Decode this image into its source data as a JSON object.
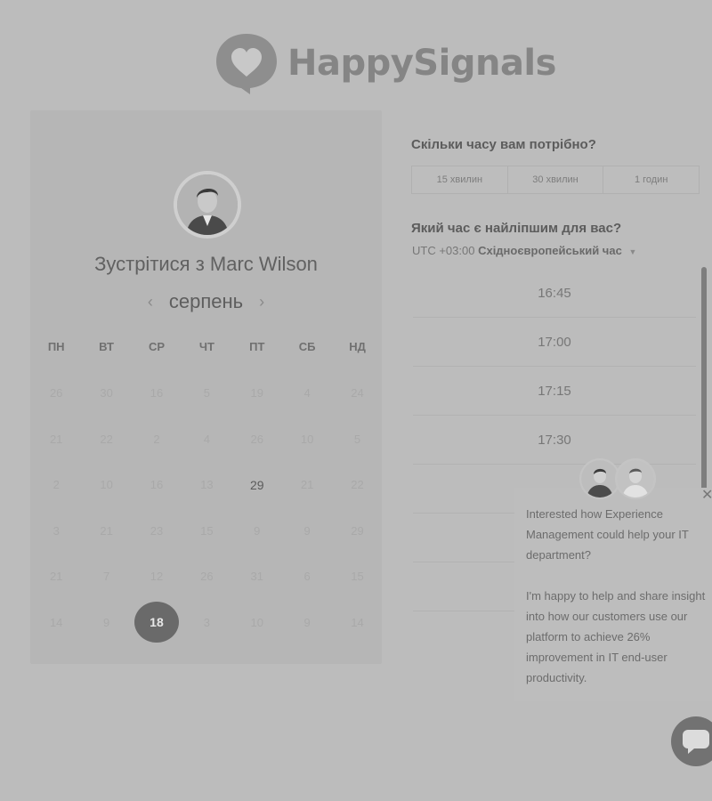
{
  "brand": {
    "name": "HappySignals"
  },
  "calendar": {
    "title": "Зустрітися з Marc Wilson",
    "month": "серпень",
    "weekdays": [
      "ПН",
      "ВТ",
      "СР",
      "ЧТ",
      "ПТ",
      "СБ",
      "НД"
    ],
    "days": [
      "26",
      "30",
      "16",
      "5",
      "19",
      "4",
      "24",
      "21",
      "22",
      "2",
      "4",
      "26",
      "10",
      "5",
      "2",
      "10",
      "16",
      "13",
      "29",
      "21",
      "22",
      "3",
      "21",
      "23",
      "15",
      "9",
      "9",
      "29",
      "21",
      "7",
      "12",
      "26",
      "31",
      "6",
      "15",
      "14",
      "9",
      "18",
      "3",
      "10",
      "9",
      "14"
    ],
    "available_day": "29",
    "selected_day": "18"
  },
  "booking": {
    "duration_question": "Скільки часу вам потрібно?",
    "durations": [
      "15 хвилин",
      "30 хвилин",
      "1 годин"
    ],
    "time_question": "Який час є найліпшим для вас?",
    "timezone_offset": "UTC +03:00",
    "timezone_name": "Східноєвропейський час",
    "slots": [
      "16:45",
      "17:00",
      "17:15",
      "17:30"
    ]
  },
  "chat": {
    "message_1": "Interested how Experience Management could help your IT department?",
    "message_2": "I'm happy to help and share insight into how our customers use our platform to achieve 26% improvement in IT end-user productivity."
  },
  "colors": {
    "background": "#bcbcbc",
    "panel": "#b6b6b6",
    "selected": "#6a6a6a"
  }
}
